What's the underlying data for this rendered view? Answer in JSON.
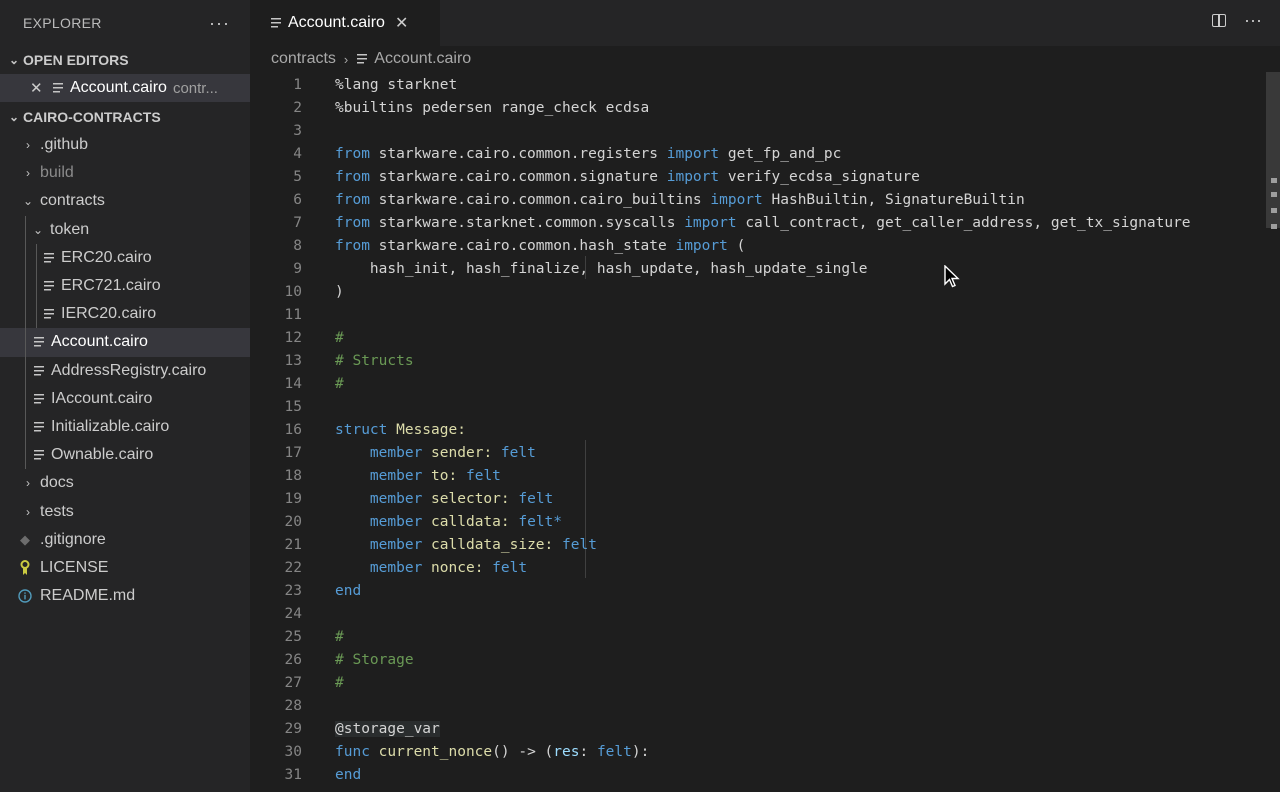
{
  "explorer": {
    "title": "EXPLORER",
    "more": "···",
    "open_editors": {
      "label": "OPEN EDITORS",
      "items": [
        {
          "name": "Account.cairo",
          "desc": "contr..."
        }
      ]
    },
    "project": {
      "label": "CAIRO-CONTRACTS",
      "items": [
        {
          "label": ".github",
          "kind": "folder"
        },
        {
          "label": "build",
          "kind": "folder"
        },
        {
          "label": "contracts",
          "kind": "folder"
        },
        {
          "label": "token",
          "kind": "folder"
        },
        {
          "label": "ERC20.cairo",
          "kind": "file"
        },
        {
          "label": "ERC721.cairo",
          "kind": "file"
        },
        {
          "label": "IERC20.cairo",
          "kind": "file"
        },
        {
          "label": "Account.cairo",
          "kind": "file"
        },
        {
          "label": "AddressRegistry.cairo",
          "kind": "file"
        },
        {
          "label": "IAccount.cairo",
          "kind": "file"
        },
        {
          "label": "Initializable.cairo",
          "kind": "file"
        },
        {
          "label": "Ownable.cairo",
          "kind": "file"
        },
        {
          "label": "docs",
          "kind": "folder"
        },
        {
          "label": "tests",
          "kind": "folder"
        },
        {
          "label": ".gitignore",
          "kind": "file"
        },
        {
          "label": "LICENSE",
          "kind": "file"
        },
        {
          "label": "README.md",
          "kind": "file"
        }
      ]
    }
  },
  "tabs": [
    {
      "label": "Account.cairo"
    }
  ],
  "tab_actions": {
    "more": "···"
  },
  "breadcrumb": {
    "folder": "contracts",
    "file": "Account.cairo"
  },
  "line_numbers": [
    "1",
    "2",
    "3",
    "4",
    "5",
    "6",
    "7",
    "8",
    "9",
    "10",
    "11",
    "12",
    "13",
    "14",
    "15",
    "16",
    "17",
    "18",
    "19",
    "20",
    "21",
    "22",
    "23",
    "24",
    "25",
    "26",
    "27",
    "28",
    "29",
    "30",
    "31"
  ],
  "code": {
    "l1": "%lang starknet",
    "l2": "%builtins pedersen range_check ecdsa",
    "l4_from": "from",
    "l4_mod": " starkware.cairo.common.registers ",
    "l4_imp": "import",
    "l4_rest": " get_fp_and_pc",
    "l5_from": "from",
    "l5_mod": " starkware.cairo.common.signature ",
    "l5_imp": "import",
    "l5_rest": " verify_ecdsa_signature",
    "l6_from": "from",
    "l6_mod": " starkware.cairo.common.cairo_builtins ",
    "l6_imp": "import",
    "l6_rest": " HashBuiltin, SignatureBuiltin",
    "l7_from": "from",
    "l7_mod": " starkware.starknet.common.syscalls ",
    "l7_imp": "import",
    "l7_rest": " call_contract, get_caller_address, get_tx_signature",
    "l8_from": "from",
    "l8_mod": " starkware.cairo.common.hash_state ",
    "l8_imp": "import",
    "l8_rest": " (",
    "l9": "    hash_init, hash_finalize, hash_update, hash_update_single",
    "l10": ")",
    "l12": "#",
    "l13": "# Structs",
    "l14": "#",
    "l16_kw": "struct",
    "l16_name": " Message:",
    "members": [
      {
        "name": "sender",
        "type": "felt"
      },
      {
        "name": "to",
        "type": "felt"
      },
      {
        "name": "selector",
        "type": "felt"
      },
      {
        "name": "calldata",
        "type": "felt*"
      },
      {
        "name": "calldata_size",
        "type": "felt"
      },
      {
        "name": "nonce",
        "type": "felt"
      }
    ],
    "member_kw": "member",
    "l23": "end",
    "l25": "#",
    "l26": "# Storage",
    "l27": "#",
    "l29": "@storage_var",
    "l30_kw": "func",
    "l30_name": "current_nonce",
    "l30_args": "() -> (",
    "l30_res": "res",
    "l30_colon": ": ",
    "l30_type": "felt",
    "l30_end": "):",
    "l31": "end"
  }
}
